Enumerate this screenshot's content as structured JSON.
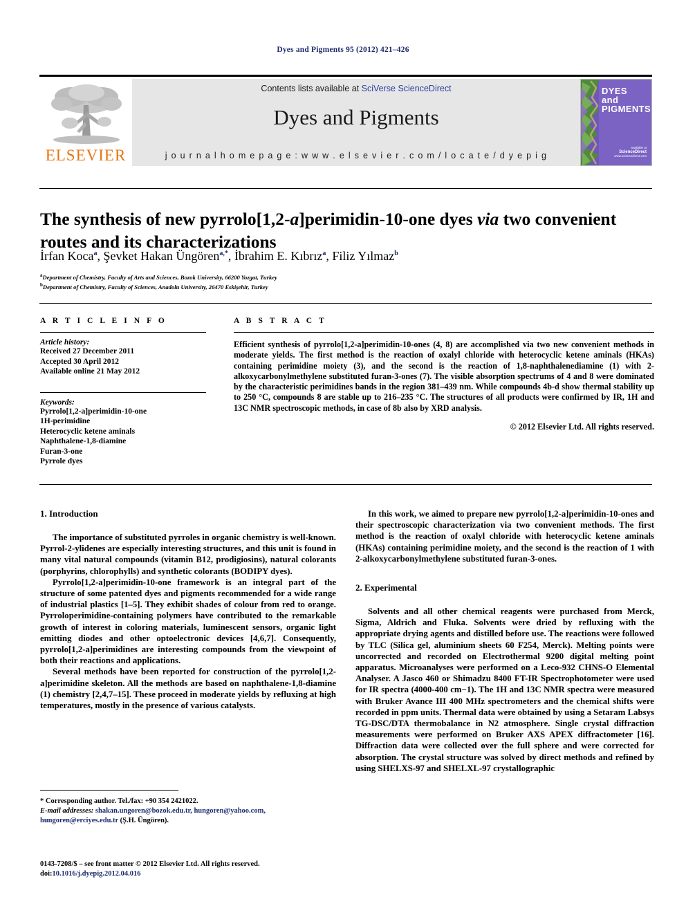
{
  "running_head": "Dyes and Pigments 95 (2012) 421–426",
  "masthead": {
    "publisher": "ELSEVIER",
    "contents_prefix": "Contents lists available at ",
    "contents_link": "SciVerse ScienceDirect",
    "journal_title": "Dyes and Pigments",
    "homepage": "j o u r n a l   h o m e p a g e :   w w w . e l s e v i e r . c o m / l o c a t e / d y e p i g",
    "cover": {
      "line1": "DYES",
      "line2": "and",
      "line3": "PIGMENTS",
      "foot_small": "available at",
      "foot_brand": "ScienceDirect",
      "foot_url": "www.sciencedirect.com",
      "bg_color": "#7b63c4"
    },
    "band_bg": "#e6e6e6"
  },
  "title": {
    "part1": "The synthesis of new pyrrolo[1,2-",
    "italic1": "a",
    "part2": "]perimidin-10-one dyes ",
    "italic2": "via",
    "part3": " two convenient routes and its characterizations"
  },
  "authors": [
    {
      "name": "İrfan Koca",
      "marks": "a"
    },
    {
      "name": "Şevket Hakan Üngören",
      "marks": "a,*"
    },
    {
      "name": "İbrahim E. Kıbrız",
      "marks": "a"
    },
    {
      "name": "Filiz Yılmaz",
      "marks": "b"
    }
  ],
  "affiliations": [
    {
      "mark": "a",
      "text": "Department of Chemistry, Faculty of Arts and Sciences, Bozok University, 66200 Yozgat, Turkey"
    },
    {
      "mark": "b",
      "text": "Department of Chemistry, Faculty of Sciences, Anadolu University, 26470 Eskişehir, Turkey"
    }
  ],
  "article_info": {
    "heading": "A R T I C L E   I N F O",
    "history_label": "Article history:",
    "history": [
      "Received 27 December 2011",
      "Accepted 30 April 2012",
      "Available online 21 May 2012"
    ],
    "keywords_label": "Keywords:",
    "keywords": [
      "Pyrrolo[1,2-a]perimidin-10-one",
      "1H-perimidine",
      "Heterocyclic ketene aminals",
      "Naphthalene-1,8-diamine",
      "Furan-3-one",
      "Pyrrole dyes"
    ]
  },
  "abstract": {
    "heading": "A B S T R A C T",
    "text": "Efficient synthesis of pyrrolo[1,2-a]perimidin-10-ones (4, 8) are accomplished via two new convenient methods in moderate yields. The first method is the reaction of oxalyl chloride with heterocyclic ketene aminals (HKAs) containing perimidine moiety (3), and the second is the reaction of 1,8-naphthalenediamine (1) with 2-alkoxycarbonylmethylene substituted furan-3-ones (7). The visible absorption spectrums of 4 and 8 were dominated by the characteristic perimidines bands in the region 381–439 nm. While compounds 4b-d show thermal stability up to 250 °C, compounds 8 are stable up to 216–235 °C. The structures of all products were confirmed by IR, 1H and 13C NMR spectroscopic methods, in case of 8b also by XRD analysis.",
    "copyright": "© 2012 Elsevier Ltd. All rights reserved."
  },
  "sections": {
    "introduction_heading": "1.  Introduction",
    "introduction_p1": "The importance of substituted pyrroles in organic chemistry is well-known. Pyrrol-2-ylidenes are especially interesting structures, and this unit is found in many vital natural compounds (vitamin B12, prodigiosins), natural colorants (porphyrins, chlorophylls) and synthetic colorants (BODIPY dyes).",
    "introduction_p2": "Pyrrolo[1,2-a]perimidin-10-one framework is an integral part of the structure of some patented dyes and pigments recommended for a wide range of industrial plastics [1–5]. They exhibit shades of colour from red to orange. Pyrroloperimidine-containing polymers have contributed to the remarkable growth of interest in coloring materials, luminescent sensors, organic light emitting diodes and other optoelectronic devices [4,6,7]. Consequently, pyrrolo[1,2-a]perimidines are interesting compounds from the viewpoint of both their reactions and applications.",
    "introduction_p3": "Several methods have been reported for construction of the pyrrolo[1,2-a]perimidine skeleton. All the methods are based on naphthalene-1,8-diamine (1) chemistry [2,4,7–15]. These proceed in moderate yields by refluxing at high temperatures, mostly in the presence of various catalysts.",
    "introduction_p4": "In this work, we aimed to prepare new pyrrolo[1,2-a]perimidin-10-ones and their spectroscopic characterization via two convenient methods. The first method is the reaction of oxalyl chloride with heterocyclic ketene aminals (HKAs) containing perimidine moiety, and the second is the reaction of 1 with 2-alkoxycarbonylmethylene substituted furan-3-ones.",
    "experimental_heading": "2.  Experimental",
    "experimental_p1": "Solvents and all other chemical reagents were purchased from Merck, Sigma, Aldrich and Fluka. Solvents were dried by refluxing with the appropriate drying agents and distilled before use. The reactions were followed by TLC (Silica gel, aluminium sheets 60 F254, Merck). Melting points were uncorrected and recorded on Electrothermal 9200 digital melting point apparatus. Microanalyses were performed on a Leco-932 CHNS-O Elemental Analyser. A Jasco 460 or Shimadzu 8400 FT-IR Spectrophotometer were used for IR spectra (4000-400 cm−1). The 1H and 13C NMR spectra were measured with Bruker Avance III 400 MHz spectrometers and the chemical shifts were recorded in ppm units. Thermal data were obtained by using a Setaram Labsys TG-DSC/DTA thermobalance in N2 atmosphere. Single crystal diffraction measurements were performed on Bruker AXS APEX diffractometer [16]. Diffraction data were collected over the full sphere and were corrected for absorption. The crystal structure was solved by direct methods and refined by using SHELXS-97 and SHELXL-97 crystallographic"
  },
  "footnote": {
    "corresponding": "* Corresponding author. Tel./fax: +90 354 2421022.",
    "email_label": "E-mail addresses:",
    "emails": "shakan.ungoren@bozok.edu.tr, hungoren@yahoo.com, hungoren@erciyes.edu.tr",
    "email_owner": "(Ş.H. Üngören).",
    "issn_line": "0143-7208/$ – see front matter © 2012 Elsevier Ltd. All rights reserved.",
    "doi_label": "doi:",
    "doi_value": "10.1016/j.dyepig.2012.04.016"
  },
  "colors": {
    "link": "#2b3f9e",
    "navy": "#1b2a6b",
    "elsevier_orange": "#e87511",
    "band_gray": "#e6e6e6"
  }
}
